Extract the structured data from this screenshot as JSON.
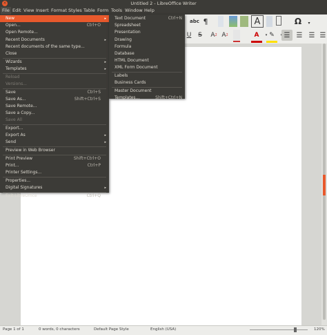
{
  "window": {
    "title": "Untitled 2 - LibreOffice Writer",
    "close_glyph": "×"
  },
  "menubar": [
    "File",
    "Edit",
    "View",
    "Insert",
    "Format",
    "Styles",
    "Table",
    "Form",
    "Tools",
    "Window",
    "Help"
  ],
  "toolbar": {
    "glyphs": [
      "abc",
      "¶",
      "A",
      "A",
      "Ω",
      "U",
      "S",
      "A",
      "A",
      "A",
      "A"
    ]
  },
  "file_menu": [
    {
      "label": "New",
      "shortcut": "",
      "arrow": "▸",
      "state": "highlighted"
    },
    {
      "label": "Open...",
      "shortcut": "Ctrl+O",
      "arrow": "",
      "state": "normal"
    },
    {
      "label": "Open Remote...",
      "shortcut": "",
      "arrow": "",
      "state": "normal"
    },
    {
      "label": "Recent Documents",
      "shortcut": "",
      "arrow": "▸",
      "state": "normal"
    },
    {
      "label": "Recent documents of the same type...",
      "shortcut": "",
      "arrow": "",
      "state": "normal"
    },
    {
      "label": "Close",
      "shortcut": "",
      "arrow": "",
      "state": "normal"
    },
    {
      "label": "Wizards",
      "shortcut": "",
      "arrow": "▸",
      "state": "normal"
    },
    {
      "label": "Templates",
      "shortcut": "",
      "arrow": "▸",
      "state": "normal"
    },
    {
      "label": "Reload",
      "shortcut": "",
      "arrow": "",
      "state": "disabled"
    },
    {
      "label": "Versions...",
      "shortcut": "",
      "arrow": "",
      "state": "disabled"
    },
    {
      "label": "Save",
      "shortcut": "Ctrl+S",
      "arrow": "",
      "state": "normal"
    },
    {
      "label": "Save As...",
      "shortcut": "Shift+Ctrl+S",
      "arrow": "",
      "state": "normal"
    },
    {
      "label": "Save Remote...",
      "shortcut": "",
      "arrow": "",
      "state": "normal"
    },
    {
      "label": "Save a Copy...",
      "shortcut": "",
      "arrow": "",
      "state": "normal"
    },
    {
      "label": "Save All",
      "shortcut": "",
      "arrow": "",
      "state": "disabled"
    },
    {
      "label": "Export...",
      "shortcut": "",
      "arrow": "",
      "state": "normal"
    },
    {
      "label": "Export As",
      "shortcut": "",
      "arrow": "▸",
      "state": "normal"
    },
    {
      "label": "Send",
      "shortcut": "",
      "arrow": "▸",
      "state": "normal"
    },
    {
      "label": "Preview in Web Browser",
      "shortcut": "",
      "arrow": "",
      "state": "normal"
    },
    {
      "label": "Print Preview",
      "shortcut": "Shift+Ctrl+O",
      "arrow": "",
      "state": "normal"
    },
    {
      "label": "Print...",
      "shortcut": "Ctrl+P",
      "arrow": "",
      "state": "normal"
    },
    {
      "label": "Printer Settings...",
      "shortcut": "",
      "arrow": "",
      "state": "normal"
    },
    {
      "label": "Properties...",
      "shortcut": "",
      "arrow": "",
      "state": "normal"
    },
    {
      "label": "Digital Signatures",
      "shortcut": "",
      "arrow": "▸",
      "state": "normal"
    },
    {
      "label": "Exit LibreOffice",
      "shortcut": "Ctrl+Q",
      "arrow": "",
      "state": "normal"
    }
  ],
  "new_submenu": [
    {
      "label": "Text Document",
      "shortcut": "Ctrl+N"
    },
    {
      "label": "Spreadsheet",
      "shortcut": ""
    },
    {
      "label": "Presentation",
      "shortcut": ""
    },
    {
      "label": "Drawing",
      "shortcut": ""
    },
    {
      "label": "Formula",
      "shortcut": ""
    },
    {
      "label": "Database",
      "shortcut": ""
    },
    {
      "label": "HTML Document",
      "shortcut": ""
    },
    {
      "label": "XML Form Document",
      "shortcut": ""
    },
    {
      "label": "Labels",
      "shortcut": ""
    },
    {
      "label": "Business Cards",
      "shortcut": ""
    },
    {
      "label": "Master Document",
      "shortcut": ""
    },
    {
      "label": "Templates...",
      "shortcut": "Shift+Ctrl+N"
    }
  ],
  "statusbar": {
    "page": "Page 1 of 1",
    "words": "0 words, 0 characters",
    "style": "Default Page Style",
    "language": "English (USA)",
    "zoom": "120%"
  },
  "colors": {
    "accent": "#e8592c",
    "menu_bg": "#3c3b37"
  }
}
